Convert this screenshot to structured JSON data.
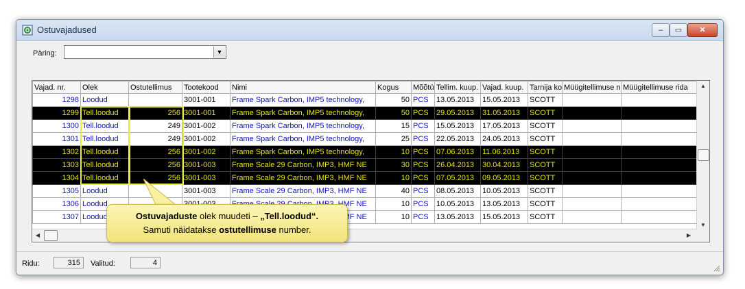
{
  "window": {
    "title": "Ostuvajadused",
    "minimize": "–",
    "maximize": "▭",
    "close": "✕"
  },
  "query": {
    "label": "Päring:",
    "value": ""
  },
  "table": {
    "columns": [
      "Vajad. nr.",
      "Olek",
      "Ostutellimus",
      "Tootekood",
      "Nimi",
      "Kogus",
      "Mõõtühik",
      "Tellim. kuup.",
      "Vajad. kuup.",
      "Tarnija kood",
      "Müügitellimuse nr",
      "Müügitellimuse rida"
    ],
    "rows": [
      {
        "sel": false,
        "cells": [
          "1298",
          "Loodud",
          "",
          "3001-001",
          "Frame Spark Carbon, IMP5 technology,",
          "50",
          "PCS",
          "13.05.2013",
          "15.05.2013",
          "SCOTT",
          "",
          ""
        ]
      },
      {
        "sel": true,
        "cells": [
          "1299",
          "Tell.loodud",
          "256",
          "3001-001",
          "Frame Spark Carbon, IMP5 technology,",
          "50",
          "PCS",
          "29.05.2013",
          "31.05.2013",
          "SCOTT",
          "",
          ""
        ]
      },
      {
        "sel": false,
        "cells": [
          "1300",
          "Tell.loodud",
          "249",
          "3001-002",
          "Frame Spark Carbon, IMP5 technology,",
          "15",
          "PCS",
          "15.05.2013",
          "17.05.2013",
          "SCOTT",
          "",
          ""
        ]
      },
      {
        "sel": false,
        "cells": [
          "1301",
          "Tell.loodud",
          "249",
          "3001-002",
          "Frame Spark Carbon, IMP5 technology,",
          "25",
          "PCS",
          "22.05.2013",
          "24.05.2013",
          "SCOTT",
          "",
          ""
        ]
      },
      {
        "sel": true,
        "cells": [
          "1302",
          "Tell.loodud",
          "256",
          "3001-002",
          "Frame Spark Carbon, IMP5 technology,",
          "10",
          "PCS",
          "07.06.2013",
          "11.06.2013",
          "SCOTT",
          "",
          ""
        ]
      },
      {
        "sel": true,
        "cells": [
          "1303",
          "Tell.loodud",
          "256",
          "3001-003",
          "Frame Scale 29 Carbon, IMP3, HMF NE",
          "30",
          "PCS",
          "26.04.2013",
          "30.04.2013",
          "SCOTT",
          "",
          ""
        ]
      },
      {
        "sel": true,
        "cells": [
          "1304",
          "Tell.loodud",
          "256",
          "3001-003",
          "Frame Scale 29 Carbon, IMP3, HMF NE",
          "10",
          "PCS",
          "07.05.2013",
          "09.05.2013",
          "SCOTT",
          "",
          ""
        ]
      },
      {
        "sel": false,
        "cells": [
          "1305",
          "Loodud",
          "",
          "3001-003",
          "Frame Scale 29 Carbon, IMP3, HMF NE",
          "40",
          "PCS",
          "08.05.2013",
          "10.05.2013",
          "SCOTT",
          "",
          ""
        ]
      },
      {
        "sel": false,
        "cells": [
          "1306",
          "Loodud",
          "",
          "3001-003",
          "Frame Scale 29 Carbon, IMP3, HMF NE",
          "10",
          "PCS",
          "10.05.2013",
          "13.05.2013",
          "SCOTT",
          "",
          ""
        ]
      },
      {
        "sel": false,
        "cells": [
          "1307",
          "Loodud",
          "",
          "3001-003",
          "Frame Scale 29 Carbon, IMP3, HMF NE",
          "10",
          "PCS",
          "13.05.2013",
          "15.05.2013",
          "SCOTT",
          "",
          ""
        ]
      }
    ]
  },
  "callout": {
    "b1": "Ostuvajaduste",
    "t1": " olek muudeti – ",
    "b2": "„Tell.loodud“.",
    "t2": "Samuti näidatakse ",
    "b3": "ostutellimuse",
    "t3": " number."
  },
  "status": {
    "rows_label": "Ridu:",
    "rows_value": "315",
    "selected_label": "Valitud:",
    "selected_value": "4"
  },
  "colors": {
    "selected_bg": "#000000",
    "selected_fg": "#e6e600",
    "link_blue": "#1010d0",
    "highlight": "#e8ef3a"
  }
}
